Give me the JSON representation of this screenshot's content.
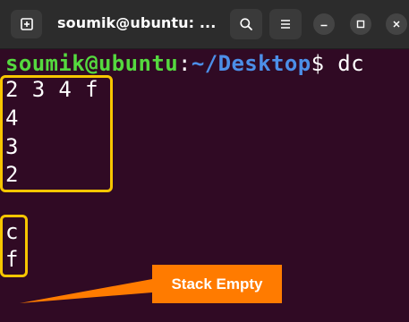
{
  "window": {
    "title": "soumik@ubuntu: ...",
    "buttons": {
      "new_tab_icon": "new-tab-icon",
      "search_icon": "search-icon",
      "menu_icon": "hamburger-menu-icon",
      "minimize_icon": "minimize-icon",
      "maximize_icon": "maximize-icon",
      "close_icon": "close-icon"
    }
  },
  "terminal": {
    "prompt": {
      "user_host": "soumik@ubuntu",
      "separator": ":",
      "path": "~/Desktop",
      "symbol": "$",
      "command": " dc"
    },
    "lines": [
      "2 3 4 f",
      "4",
      "3",
      "2",
      "c",
      "f"
    ]
  },
  "annotations": {
    "callout_text": "Stack Empty"
  },
  "colors": {
    "terminal_background": "#300a24",
    "titlebar_background": "#2c2c2c",
    "prompt_user": "#55d93f",
    "prompt_path": "#4c8fe8",
    "highlight_box": "#f7c600",
    "callout": "#ff7b00"
  }
}
